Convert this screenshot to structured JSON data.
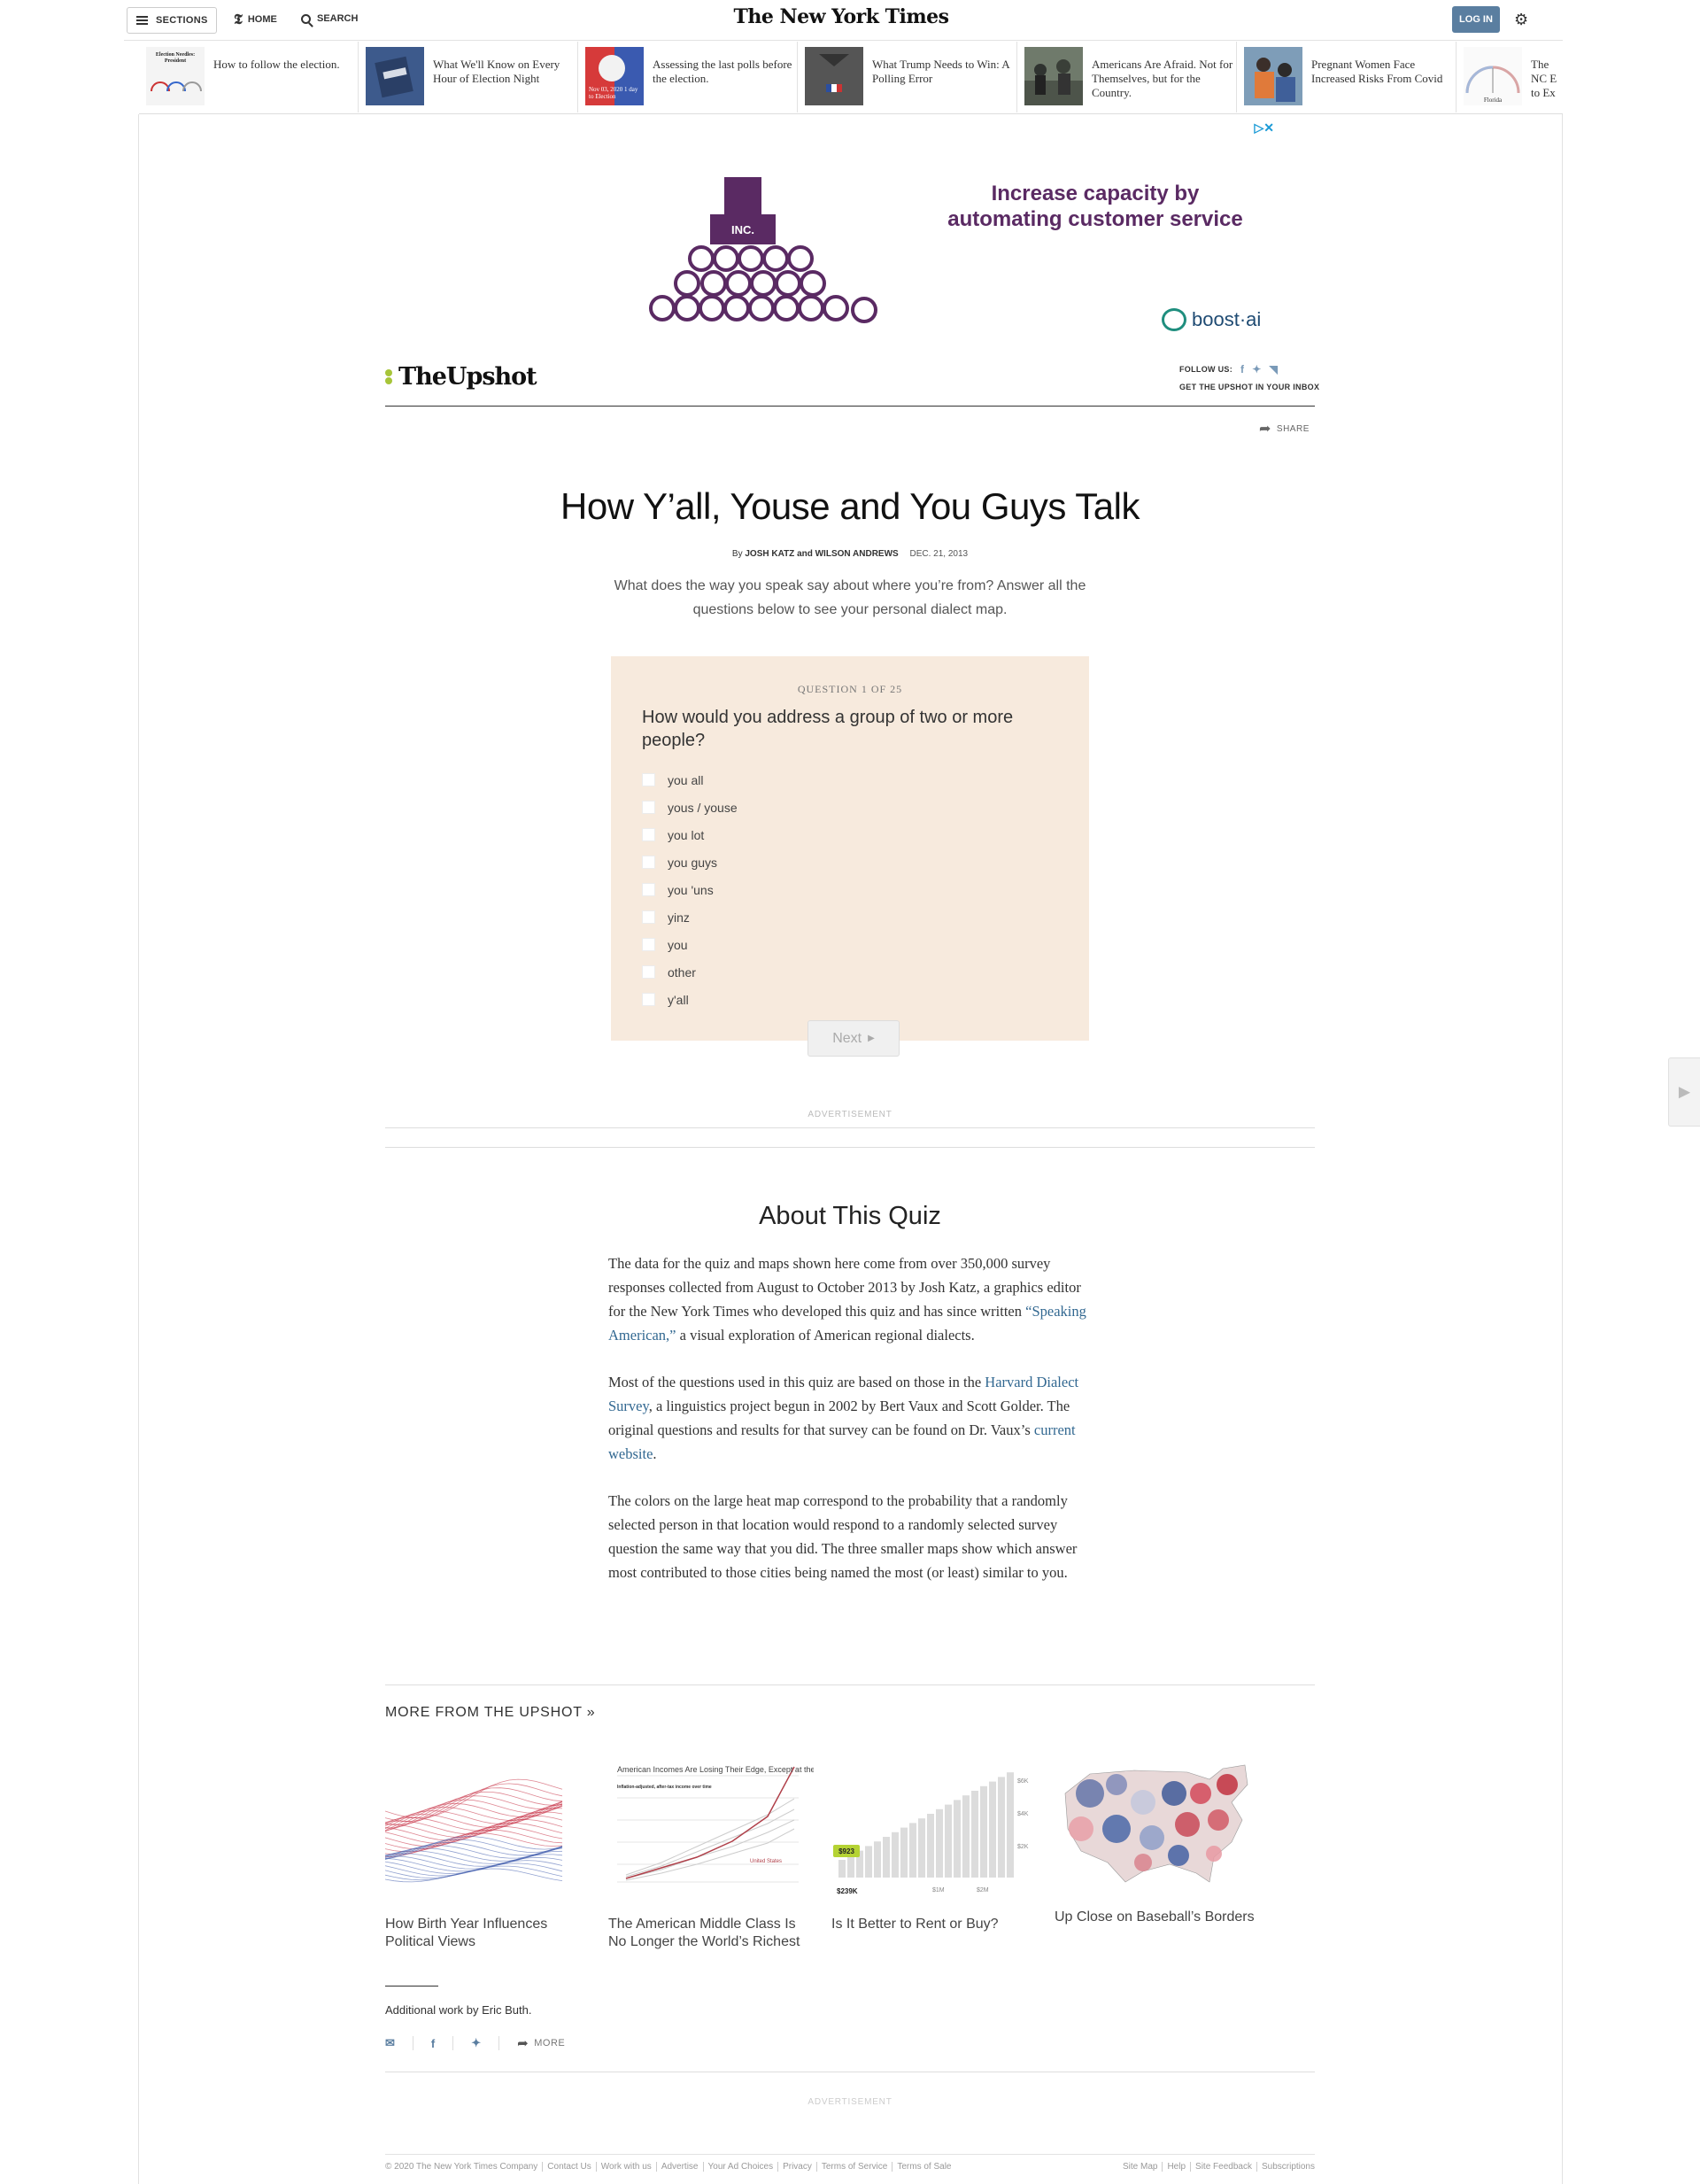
{
  "topbar": {
    "sections_label": "SECTIONS",
    "home_label": "HOME",
    "search_label": "SEARCH",
    "logo_text": "The New York Times",
    "login_label": "LOG IN"
  },
  "ribbon": [
    {
      "title": "How to follow the election.",
      "thumb_text": "Election Needles: President"
    },
    {
      "title": "What We'll Know on Every Hour of Election Night",
      "thumb_text": ""
    },
    {
      "title": "Assessing the last polls before the election.",
      "thumb_text": "Nov 03, 2020 1 day to Election"
    },
    {
      "title": "What Trump Needs to Win: A Polling Error",
      "thumb_text": ""
    },
    {
      "title": "Americans Are Afraid. Not for Themselves, but for the Country.",
      "thumb_text": ""
    },
    {
      "title": "Pregnant Women Face Increased Risks From Covid",
      "thumb_text": ""
    },
    {
      "title": "The NC E to Ex",
      "thumb_text": "Florida"
    }
  ],
  "ad": {
    "headline": "Increase capacity by automating customer service",
    "brand": "boost·ai",
    "sign_text": "INC."
  },
  "upshot": {
    "logo": "TheUpshot",
    "follow_label": "FOLLOW US:",
    "inbox_label": "GET THE UPSHOT IN YOUR INBOX",
    "share_label": "SHARE"
  },
  "article": {
    "title": "How Y’all, Youse and You Guys Talk",
    "byline_prefix": "By",
    "authors": "JOSH KATZ and WILSON ANDREWS",
    "date": "DEC. 21, 2013",
    "dek": "What does the way you speak say about where you’re from? Answer all the questions below to see your personal dialect map."
  },
  "quiz": {
    "counter": "QUESTION 1 OF 25",
    "question": "How would you address a group of two or more people?",
    "options": [
      "you all",
      "yous / youse",
      "you lot",
      "you guys",
      "you 'uns",
      "yinz",
      "you",
      "other",
      "y'all"
    ],
    "next_label": "Next"
  },
  "ad_label": "ADVERTISEMENT",
  "about": {
    "heading": "About This Quiz",
    "p1_a": "The data for the quiz and maps shown here come from over 350,000 survey responses collected from August to October 2013 by Josh Katz, a graphics editor for the New York Times who developed this quiz and has since written ",
    "p1_link": "“Speaking American,”",
    "p1_b": " a visual exploration of American regional dialects.",
    "p2_a": "Most of the questions used in this quiz are based on those in the ",
    "p2_link1": "Harvard Dialect Survey",
    "p2_b": ", a linguistics project begun in 2002 by Bert Vaux and Scott Golder. The original questions and results for that survey can be found on Dr. Vaux’s ",
    "p2_link2": "current website",
    "p2_c": ".",
    "p3": "The colors on the large heat map correspond to the probability that a randomly selected person in that location would respond to a randomly selected survey question the same way that you did. The three smaller maps show which answer most contributed to those cities being named the most (or least) similar to you."
  },
  "more": {
    "heading": "MORE FROM THE UPSHOT »",
    "items": [
      {
        "caption": "How Birth Year Influences Political Views"
      },
      {
        "caption": "The American Middle Class Is No Longer the World’s Richest",
        "thumb_title": "American Incomes Are Losing Their Edge, Except at the Top",
        "thumb_sub": "Inflation-adjusted, after-tax income over time",
        "thumb_series": "United States"
      },
      {
        "caption": "Is It Better to Rent or Buy?",
        "thumb_badge": "$923",
        "thumb_value": "$239K",
        "thumb_ticks": [
          "$6K",
          "$4K",
          "$2K"
        ],
        "thumb_xticks": [
          "$1M",
          "$2M"
        ]
      },
      {
        "caption": "Up Close on Baseball’s Borders"
      }
    ]
  },
  "credits": {
    "text": "Additional work by Eric Buth.",
    "more_label": "MORE"
  },
  "footer": {
    "left": [
      "© 2020 The New York Times Company",
      "Contact Us",
      "Work with us",
      "Advertise",
      "Your Ad Choices",
      "Privacy",
      "Terms of Service",
      "Terms of Sale"
    ],
    "right": [
      "Site Map",
      "Help",
      "Site Feedback",
      "Subscriptions"
    ]
  },
  "colors": {
    "quiz_bg": "#f7eadd",
    "link": "#326891",
    "login_bg": "#5a7ea0",
    "upshot_accent": "#a7c539",
    "ad_purple": "#5a2a63"
  }
}
